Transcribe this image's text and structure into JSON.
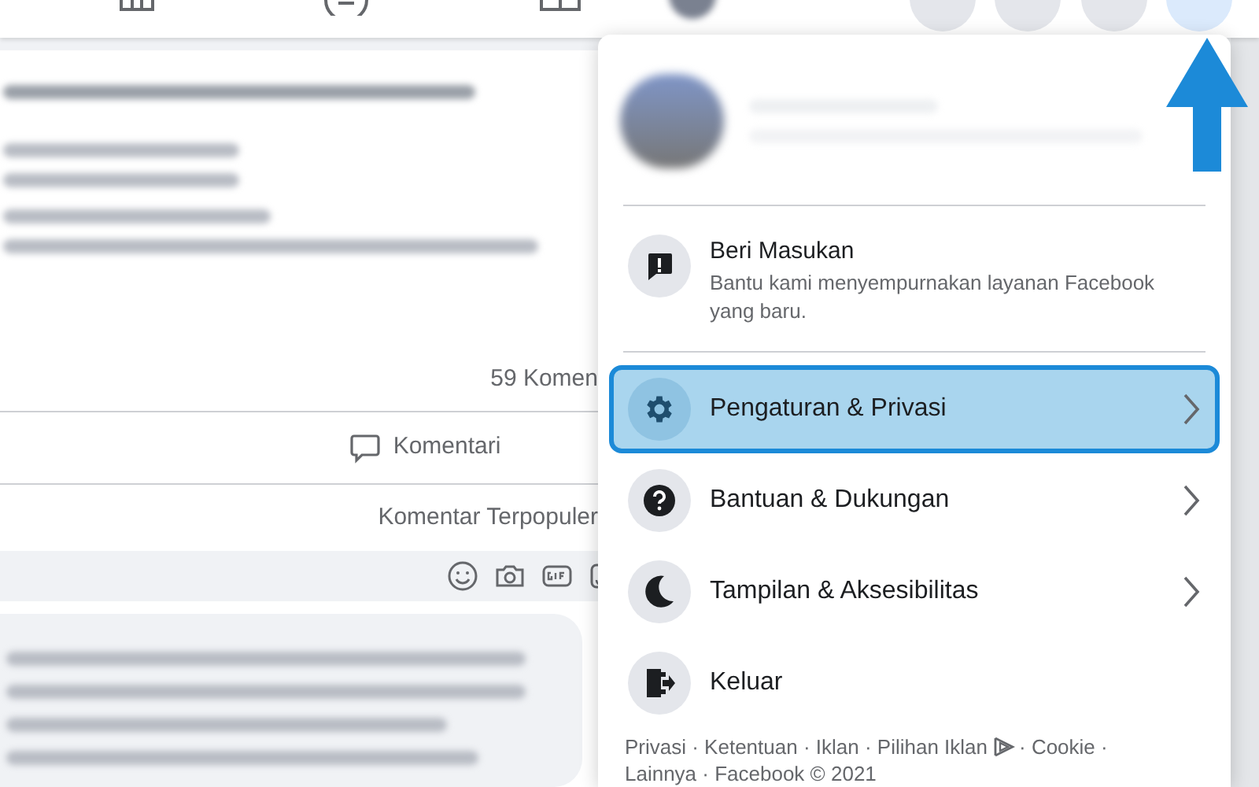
{
  "post": {
    "comment_count": "59 Komen",
    "comment_button": "Komentari",
    "sort_label": "Komentar Terpopuler"
  },
  "menu": {
    "items": [
      {
        "kind": "feedback",
        "label": "Beri Masukan",
        "subtitle": "Bantu kami menyempurnakan layanan Facebook yang baru.",
        "selected": false
      },
      {
        "kind": "link",
        "label": "Pengaturan & Privasi",
        "selected": true
      },
      {
        "kind": "link",
        "label": "Bantuan & Dukungan",
        "selected": false
      },
      {
        "kind": "link",
        "label": "Tampilan & Aksesibilitas",
        "selected": false
      },
      {
        "kind": "action",
        "label": "Keluar",
        "selected": false
      }
    ],
    "footer": {
      "before_icon": "Privasi · Ketentuan · Iklan · Pilihan Iklan",
      "after_icon": "· Cookie ·",
      "second_line": "Lainnya · Facebook © 2021"
    }
  }
}
